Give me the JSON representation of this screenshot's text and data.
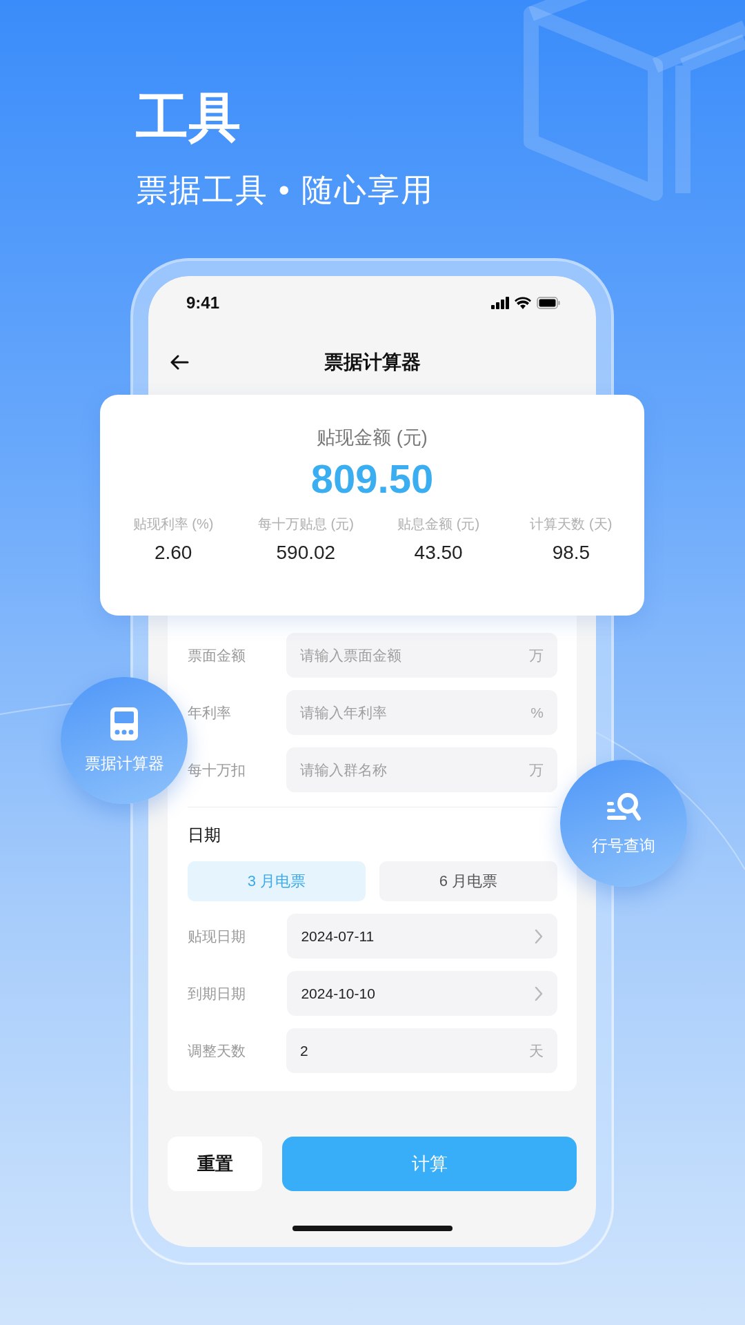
{
  "promo": {
    "title": "工具",
    "subtitle": "票据工具 • 随心享用"
  },
  "status_bar": {
    "time": "9:41"
  },
  "nav": {
    "title": "票据计算器"
  },
  "result": {
    "label": "贴现金额 (元)",
    "amount": "809.50",
    "stats": [
      {
        "label": "贴现利率 (%)",
        "value": "2.60"
      },
      {
        "label": "每十万贴息 (元)",
        "value": "590.02"
      },
      {
        "label": "贴息金额 (元)",
        "value": "43.50"
      },
      {
        "label": "计算天数 (天)",
        "value": "98.5"
      }
    ]
  },
  "inputs": [
    {
      "label": "票面金额",
      "placeholder": "请输入票面金额",
      "unit": "万"
    },
    {
      "label": "年利率",
      "placeholder": "请输入年利率",
      "unit": "%"
    },
    {
      "label": "每十万扣",
      "placeholder": "请输入群名称",
      "unit": "万"
    }
  ],
  "date_section": {
    "title": "日期",
    "options": [
      {
        "label": "3 月电票",
        "selected": true
      },
      {
        "label": "6 月电票",
        "selected": false
      }
    ],
    "rows": [
      {
        "kind": "picker",
        "label": "贴现日期",
        "value": "2024-07-11"
      },
      {
        "kind": "picker",
        "label": "到期日期",
        "value": "2024-10-10"
      },
      {
        "kind": "input",
        "label": "调整天数",
        "value": "2",
        "unit": "天"
      }
    ]
  },
  "actions": {
    "reset": "重置",
    "calculate": "计算"
  },
  "badges": [
    {
      "label": "票据计算器"
    },
    {
      "label": "行号查询"
    }
  ]
}
